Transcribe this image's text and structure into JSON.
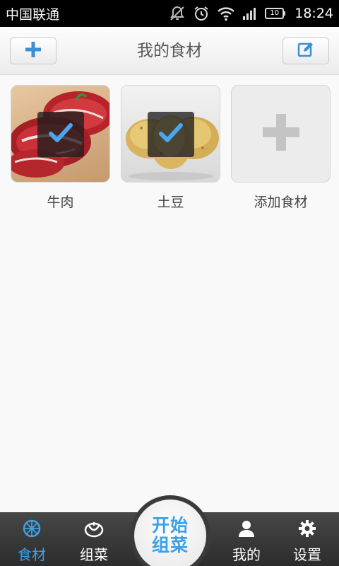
{
  "status_bar": {
    "carrier": "中国联通",
    "battery": "10",
    "time": "18:24"
  },
  "header": {
    "title": "我的食材",
    "add_icon": "plus-icon",
    "edit_icon": "edit-icon"
  },
  "ingredients": [
    {
      "label": "牛肉",
      "selected": true,
      "image": "beef-photo"
    },
    {
      "label": "土豆",
      "selected": true,
      "image": "potato-photo"
    }
  ],
  "add_tile": {
    "label": "添加食材",
    "icon": "plus-icon"
  },
  "bottom_nav": {
    "food": "食材",
    "combo": "组菜",
    "start_line1": "开始",
    "start_line2": "组菜",
    "me": "我的",
    "settings": "设置",
    "active": "food"
  },
  "colors": {
    "accent": "#3aa0e8",
    "bar": "#333333"
  }
}
